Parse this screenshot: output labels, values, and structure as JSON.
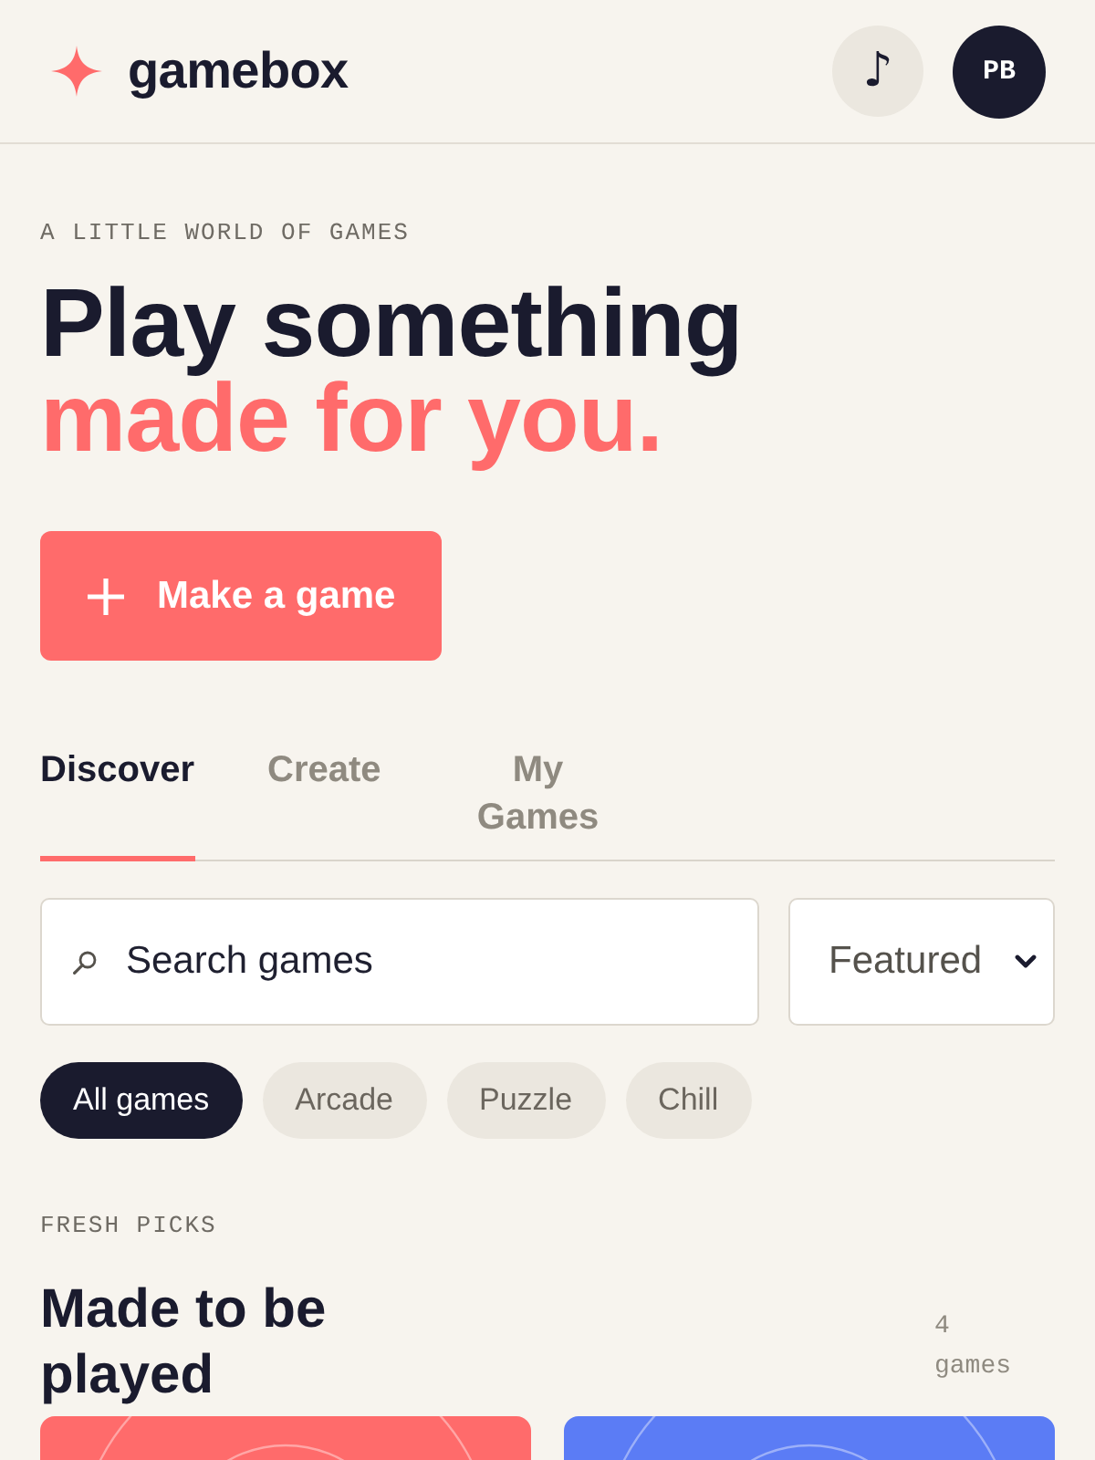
{
  "header": {
    "brand": "gamebox",
    "music_button": "♪",
    "avatar": "PB"
  },
  "hero": {
    "eyebrow": "A LITTLE WORLD OF GAMES",
    "title": "Play something",
    "title_accent": "made for you.",
    "cta": "Make a game"
  },
  "tabs": [
    {
      "label": "Discover",
      "selected": true
    },
    {
      "label": "Create",
      "selected": false
    },
    {
      "label": "My Games",
      "selected": false
    }
  ],
  "search": {
    "placeholder": "Search games"
  },
  "sort": {
    "value": "Featured"
  },
  "filters": [
    {
      "label": "All games",
      "selected": true
    },
    {
      "label": "Arcade",
      "selected": false
    },
    {
      "label": "Puzzle",
      "selected": false
    },
    {
      "label": "Chill",
      "selected": false
    }
  ],
  "picks": {
    "eyebrow": "FRESH PICKS",
    "title": "Made to be played",
    "count": "4 games",
    "games": [
      {
        "color": "#ff6b6b"
      },
      {
        "color": "#5b7cf5"
      }
    ]
  }
}
